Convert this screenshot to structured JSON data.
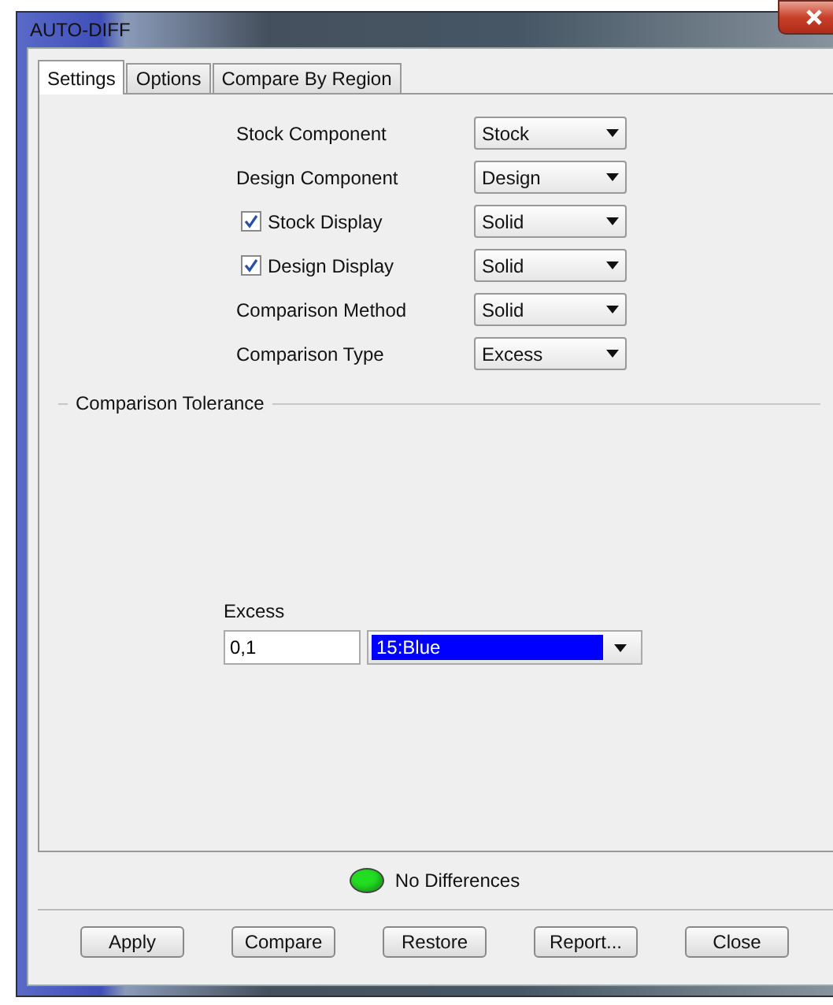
{
  "window": {
    "title": "AUTO-DIFF"
  },
  "tabs": [
    {
      "label": "Settings",
      "selected": true
    },
    {
      "label": "Options",
      "selected": false
    },
    {
      "label": "Compare By Region",
      "selected": false
    }
  ],
  "settings": [
    {
      "kind": "label",
      "label": "Stock Component",
      "value": "Stock"
    },
    {
      "kind": "label",
      "label": "Design Component",
      "value": "Design"
    },
    {
      "kind": "checkbox",
      "label": "Stock Display",
      "checked": true,
      "value": "Solid"
    },
    {
      "kind": "checkbox",
      "label": "Design Display",
      "checked": true,
      "value": "Solid"
    },
    {
      "kind": "label",
      "label": "Comparison Method",
      "value": "Solid"
    },
    {
      "kind": "label",
      "label": "Comparison Type",
      "value": "Excess"
    }
  ],
  "tolerance": {
    "title": "Comparison Tolerance",
    "label": "Excess",
    "value": "0,1",
    "color_choice": {
      "value": "15:Blue",
      "highlighted": true
    }
  },
  "status": {
    "text": "No Differences",
    "color": "#22dd22"
  },
  "buttons": [
    "Apply",
    "Compare",
    "Restore",
    "Report...",
    "Close"
  ]
}
